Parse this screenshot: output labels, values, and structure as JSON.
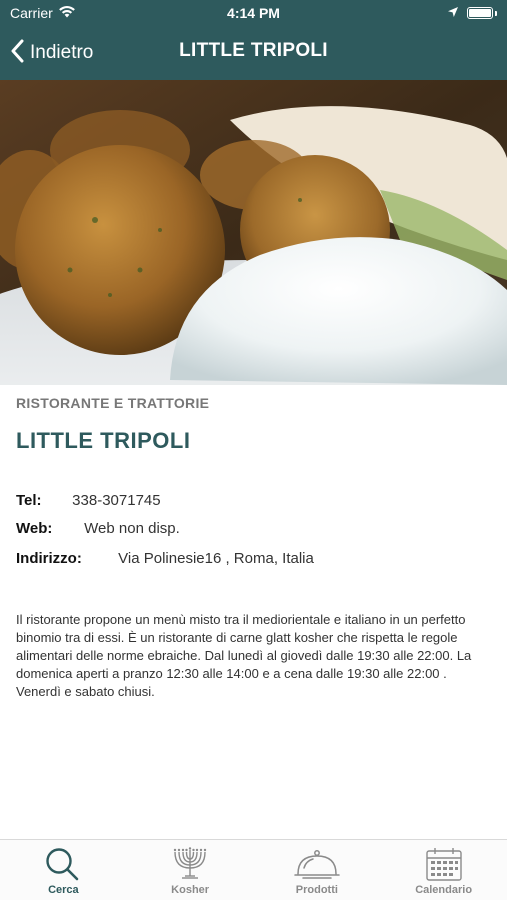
{
  "status_bar": {
    "carrier": "Carrier",
    "time": "4:14 PM",
    "icons": [
      "wifi-icon",
      "location-arrow-icon",
      "battery-icon"
    ]
  },
  "nav": {
    "back_label": "Indietro",
    "back_icon": "chevron-left-icon",
    "title": "LITTLE TRIPOLI"
  },
  "hero": {
    "icon": "falafel-photo"
  },
  "restaurant": {
    "category": "RISTORANTE E TRATTORIE",
    "name": "LITTLE TRIPOLI",
    "tel_label": "Tel:",
    "tel_value": "338-3071745",
    "web_label": "Web:",
    "web_value": "Web non disp.",
    "address_label": "Indirizzo:",
    "address_value": "Via Polinesie16 , Roma, Italia",
    "description": "Il ristorante propone un menù misto tra il mediorientale e italiano in un perfetto binomio tra di essi. È un ristorante di carne glatt kosher che rispetta le regole alimentari delle norme ebraiche. Dal lunedì al giovedì dalle 19:30 alle 22:00. La domenica aperti a pranzo 12:30 alle 14:00 e a cena dalle 19:30 alle 22:00 . Venerdì e sabato chiusi."
  },
  "tabs": [
    {
      "label": "Cerca",
      "icon": "search-icon",
      "active": true
    },
    {
      "label": "Kosher",
      "icon": "menorah-icon",
      "active": false
    },
    {
      "label": "Prodotti",
      "icon": "cloche-icon",
      "active": false
    },
    {
      "label": "Calendario",
      "icon": "calendar-icon",
      "active": false
    }
  ],
  "colors": {
    "brand": "#2e5a5d",
    "tab_inactive": "#8a8a8a",
    "category_gray": "#777777"
  }
}
